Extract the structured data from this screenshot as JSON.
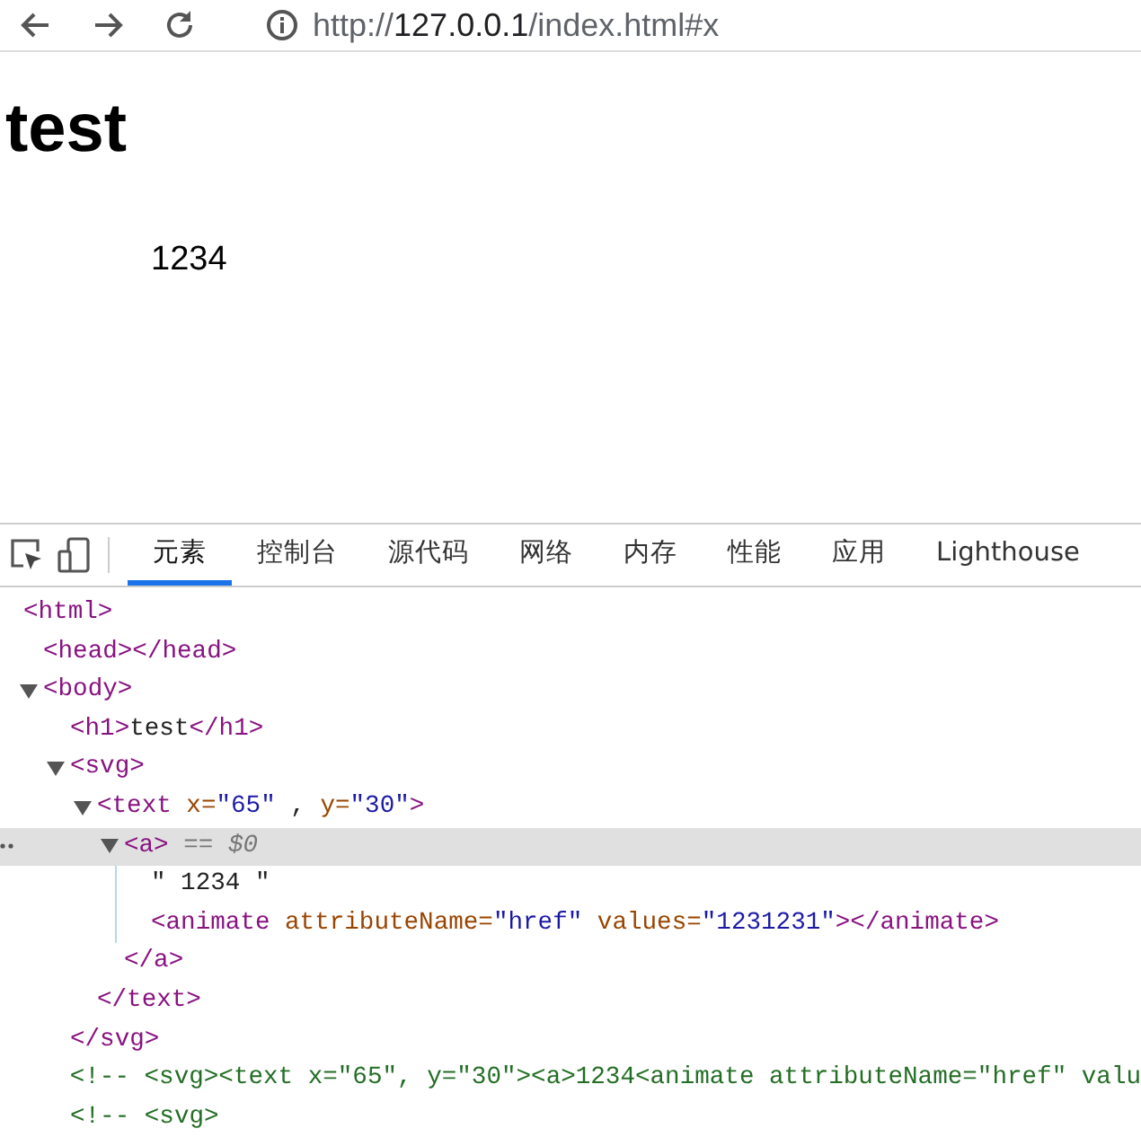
{
  "address_bar": {
    "scheme": "http://",
    "host": "127.0.0.1",
    "path": "/index.html#x"
  },
  "page": {
    "heading": "test",
    "svg_text": "1234"
  },
  "devtools": {
    "tabs": [
      {
        "label": "元素",
        "selected": true
      },
      {
        "label": "控制台",
        "selected": false
      },
      {
        "label": "源代码",
        "selected": false
      },
      {
        "label": "网络",
        "selected": false
      },
      {
        "label": "内存",
        "selected": false
      },
      {
        "label": "性能",
        "selected": false
      },
      {
        "label": "应用",
        "selected": false
      },
      {
        "label": "Lighthouse",
        "selected": false
      }
    ],
    "tree": [
      {
        "selected": false,
        "tokens": [
          {
            "kind": "tag",
            "text": "<html>"
          }
        ],
        "children": [
          {
            "selected": false,
            "tokens": [
              {
                "kind": "tag",
                "text": "<head></head>"
              }
            ]
          },
          {
            "selected": false,
            "expanded": true,
            "tokens": [
              {
                "kind": "tag",
                "text": "<body>"
              }
            ],
            "children": [
              {
                "selected": false,
                "tokens": [
                  {
                    "kind": "tag",
                    "text": "<h1>"
                  },
                  {
                    "kind": "text",
                    "text": "test"
                  },
                  {
                    "kind": "tag",
                    "text": "</h1>"
                  }
                ]
              },
              {
                "selected": false,
                "expanded": true,
                "tokens": [
                  {
                    "kind": "tag",
                    "text": "<svg>"
                  }
                ],
                "closing": [
                  {
                    "kind": "tag",
                    "text": "</svg>"
                  }
                ],
                "children": [
                  {
                    "selected": false,
                    "expanded": true,
                    "tokens": [
                      {
                        "kind": "tag",
                        "text": "<text"
                      },
                      {
                        "kind": "attr",
                        "text": " x="
                      },
                      {
                        "kind": "value",
                        "text": "\"65\""
                      },
                      {
                        "kind": "text",
                        "text": " , "
                      },
                      {
                        "kind": "attr",
                        "text": "y="
                      },
                      {
                        "kind": "value",
                        "text": "\"30\""
                      },
                      {
                        "kind": "tag",
                        "text": ">"
                      }
                    ],
                    "closing": [
                      {
                        "kind": "tag",
                        "text": "</text>"
                      }
                    ],
                    "children": [
                      {
                        "selected": true,
                        "expanded": true,
                        "tokens": [
                          {
                            "kind": "tag",
                            "text": "<a>"
                          },
                          {
                            "kind": "marker",
                            "text": " == $0"
                          }
                        ],
                        "closing": [
                          {
                            "kind": "tag",
                            "text": "</a>"
                          }
                        ],
                        "children": [
                          {
                            "selected": false,
                            "tokens": [
                              {
                                "kind": "text",
                                "text": "\" 1234 \""
                              }
                            ]
                          },
                          {
                            "selected": false,
                            "tokens": [
                              {
                                "kind": "tag",
                                "text": "<animate"
                              },
                              {
                                "kind": "attr",
                                "text": " attributeName="
                              },
                              {
                                "kind": "value",
                                "text": "\"href\""
                              },
                              {
                                "kind": "attr",
                                "text": " values="
                              },
                              {
                                "kind": "value",
                                "text": "\"1231231\""
                              },
                              {
                                "kind": "tag",
                                "text": "></animate>"
                              }
                            ]
                          }
                        ]
                      }
                    ]
                  }
                ]
              },
              {
                "selected": false,
                "tokens": [
                  {
                    "kind": "comment",
                    "text": "<!-- <svg><text x=\"65\", y=\"30\"><a>1234<animate attributeName=\"href\" valu"
                  }
                ]
              },
              {
                "selected": false,
                "tokens": [
                  {
                    "kind": "comment",
                    "text": "<!-- <svg>"
                  }
                ]
              }
            ]
          }
        ]
      }
    ]
  }
}
